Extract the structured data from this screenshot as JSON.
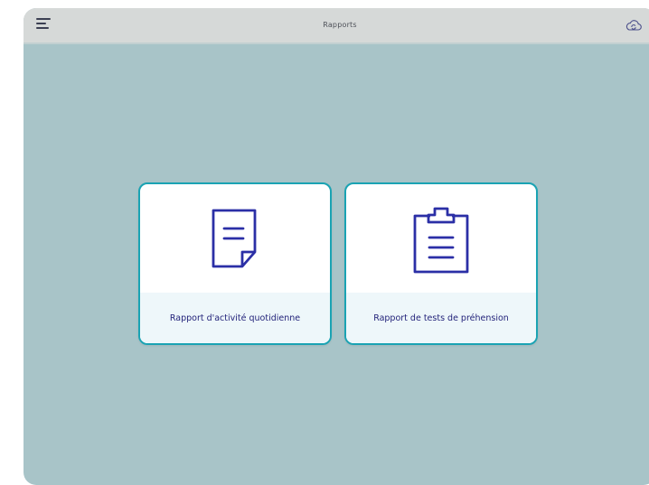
{
  "header": {
    "title": "Rapports",
    "menu_icon": "hamburger-menu-icon",
    "sync_icon": "cloud-sync-icon"
  },
  "reports": [
    {
      "label": "Rapport d'activité quotidienne",
      "icon": "document-icon"
    },
    {
      "label": "Rapport de tests de préhension",
      "icon": "clipboard-icon"
    }
  ],
  "colors": {
    "background": "#a8c4c8",
    "topbar": "#d6d9d8",
    "card_border": "#1aa3b3",
    "icon_stroke": "#2b2fa6",
    "label_text": "#23237a",
    "label_bg": "#eef7fa"
  }
}
